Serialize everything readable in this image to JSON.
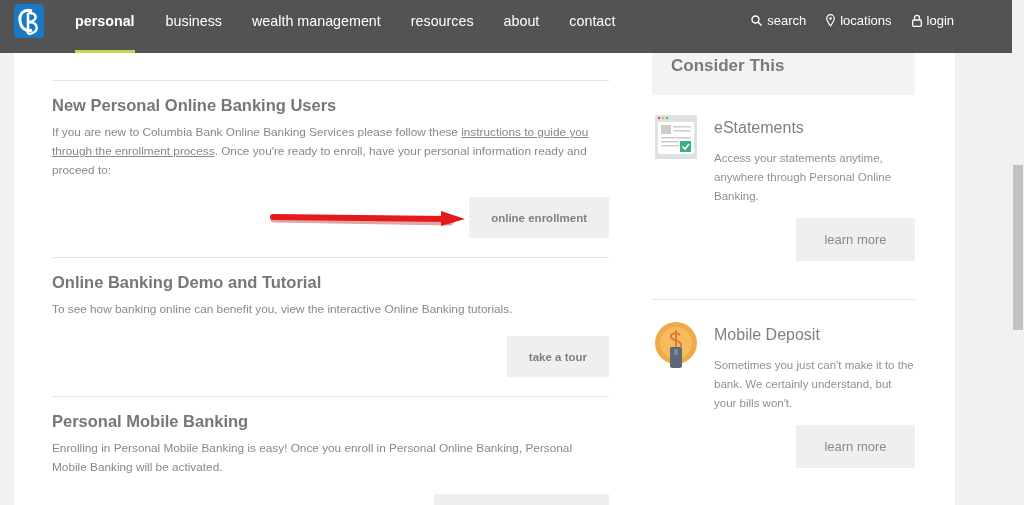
{
  "nav": {
    "items": [
      {
        "label": "personal",
        "selected": true
      },
      {
        "label": "business",
        "selected": false
      },
      {
        "label": "wealth management",
        "selected": false
      },
      {
        "label": "resources",
        "selected": false
      },
      {
        "label": "about",
        "selected": false
      },
      {
        "label": "contact",
        "selected": false
      }
    ],
    "utility": [
      {
        "label": "search",
        "kind": "search"
      },
      {
        "label": "locations",
        "kind": "pin"
      },
      {
        "label": "login",
        "kind": "lock"
      }
    ]
  },
  "sections": [
    {
      "title": "New Personal Online Banking Users",
      "body_before": "If you are new to Columbia Bank Online Banking Services please follow these ",
      "link": [
        "instructions to guide you",
        "through the enrollment process"
      ],
      "body_after": ". Once you're ready to enroll, have your personal information ready and proceed to:",
      "button": "online enrollment",
      "arrow": true
    },
    {
      "title": "Online Banking Demo and Tutorial",
      "body_before": "To see how banking online can benefit you, view the interactive Online Banking tutorials.",
      "button": "take a tour",
      "arrow": false
    },
    {
      "title": "Personal Mobile Banking",
      "body_before": "Enrolling in Personal Mobile Banking is easy! Once you enroll in Personal Online Banking, Personal Mobile Banking will be activated.",
      "button_cut_off": true,
      "arrow": false
    }
  ],
  "sidebar": {
    "title": "Consider This",
    "cards": [
      {
        "kind": "document",
        "title": "eStatements",
        "text": "Access your statements anytime, anywhere through Personal Online Banking.",
        "button": "learn more"
      },
      {
        "kind": "coin",
        "title": "Mobile Deposit",
        "text": "Sometimes you just can't make it to the bank. We certainly understand, but your bills won't.",
        "button": "learn more"
      }
    ]
  }
}
